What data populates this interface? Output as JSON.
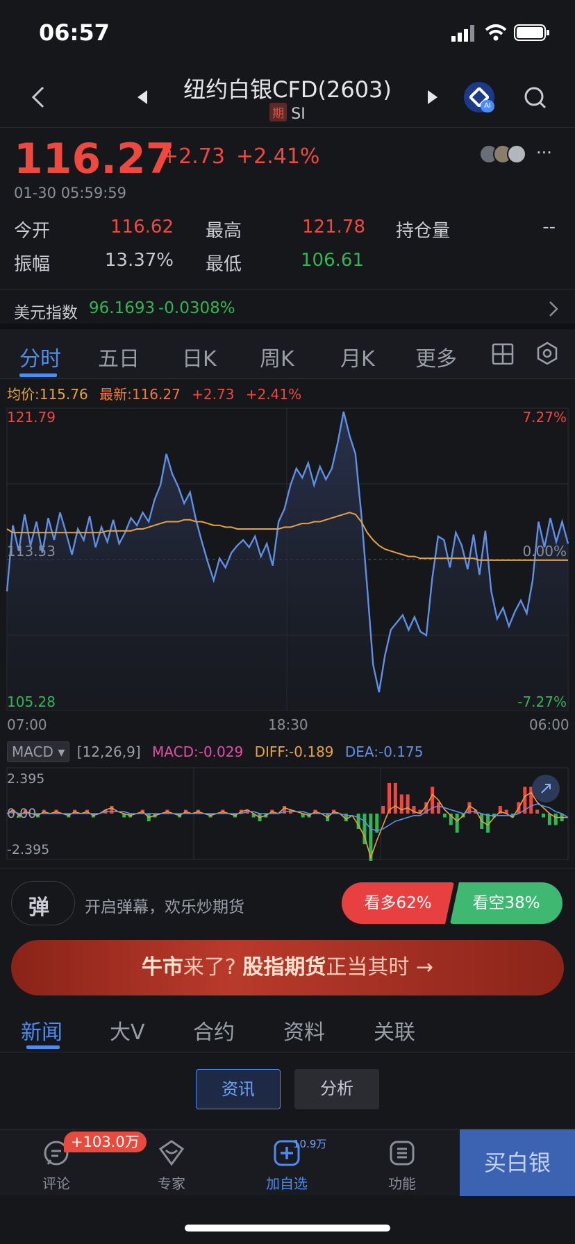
{
  "status_bar": {
    "time": "06:57"
  },
  "nav": {
    "title": "纽约白银CFD(2603)",
    "tag": "期",
    "symbol": "SI",
    "ai_badge": "AI"
  },
  "quote": {
    "price": "116.27",
    "change": "+2.73",
    "change_pct": "+2.41%",
    "timestamp": "01-30 05:59:59",
    "more": "···"
  },
  "stats": {
    "open_label": "今开",
    "open_value": "116.62",
    "high_label": "最高",
    "high_value": "121.78",
    "oi_label": "持仓量",
    "oi_value": "--",
    "amp_label": "振幅",
    "amp_value": "13.37%",
    "low_label": "最低",
    "low_value": "106.61"
  },
  "usd_index": {
    "label": "美元指数",
    "value": "96.1693",
    "change": "-0.0308%"
  },
  "chart_tabs": [
    "分时",
    "五日",
    "日K",
    "周K",
    "月K",
    "更多"
  ],
  "legend": {
    "avg": "均价:115.76",
    "latest": "最新:116.27",
    "change": "+2.73",
    "change_pct": "+2.41%"
  },
  "chart_data": [
    {
      "type": "line",
      "series": [
        {
          "name": "最新",
          "color": "#5f8fe6"
        },
        {
          "name": "均价",
          "color": "#e8a33d"
        }
      ],
      "x_ticks": [
        "07:00",
        "18:30",
        "06:00"
      ],
      "y_labels": {
        "top": "121.79",
        "mid": "113.53",
        "bottom": "105.28"
      },
      "pct_labels": {
        "top": "7.27%",
        "mid": "0.00%",
        "bottom": "-7.27%"
      },
      "ylim": [
        105.28,
        121.79
      ],
      "reference": 113.53,
      "price": [
        111.8,
        115.4,
        114.0,
        116.0,
        114.3,
        115.6,
        113.9,
        115.8,
        114.6,
        116.1,
        115.0,
        113.8,
        115.2,
        114.6,
        115.9,
        114.2,
        115.3,
        114.5,
        115.7,
        114.4,
        115.0,
        115.8,
        115.4,
        116.1,
        115.6,
        116.8,
        117.6,
        119.3,
        118.2,
        117.5,
        116.6,
        117.2,
        115.7,
        114.5,
        113.4,
        112.4,
        113.6,
        113.1,
        113.9,
        114.3,
        114.6,
        114.2,
        114.8,
        113.7,
        114.4,
        113.2,
        115.6,
        116.3,
        117.6,
        118.5,
        118.0,
        118.8,
        117.6,
        118.6,
        117.9,
        118.5,
        119.9,
        121.6,
        120.3,
        119.3,
        116.0,
        112.0,
        107.8,
        106.3,
        108.3,
        109.7,
        110.1,
        110.5,
        109.7,
        110.4,
        109.6,
        109.4,
        112.5,
        114.8,
        114.6,
        113.1,
        115.0,
        114.3,
        113.0,
        114.9,
        112.7,
        115.1,
        111.8,
        110.3,
        110.9,
        109.9,
        110.7,
        111.3,
        110.6,
        112.4,
        115.6,
        114.2,
        115.8,
        114.5,
        115.6,
        114.4
      ],
      "avg": [
        115.2,
        115.0,
        115.0,
        115.0,
        115.0,
        115.0,
        115.0,
        115.0,
        115.0,
        115.0,
        115.0,
        115.0,
        115.0,
        115.0,
        115.0,
        115.0,
        115.0,
        115.1,
        115.1,
        115.1,
        115.1,
        115.1,
        115.2,
        115.2,
        115.3,
        115.4,
        115.5,
        115.6,
        115.6,
        115.6,
        115.7,
        115.7,
        115.6,
        115.6,
        115.5,
        115.4,
        115.4,
        115.3,
        115.3,
        115.2,
        115.2,
        115.2,
        115.2,
        115.2,
        115.2,
        115.2,
        115.2,
        115.3,
        115.3,
        115.4,
        115.5,
        115.5,
        115.6,
        115.6,
        115.7,
        115.8,
        115.9,
        116.0,
        116.1,
        116.0,
        115.6,
        115.0,
        114.6,
        114.3,
        114.1,
        114.0,
        113.9,
        113.8,
        113.7,
        113.7,
        113.6,
        113.6,
        113.6,
        113.6,
        113.6,
        113.6,
        113.6,
        113.6,
        113.6,
        113.6,
        113.5,
        113.5,
        113.5,
        113.5,
        113.5,
        113.5,
        113.5,
        113.5,
        113.5,
        113.5,
        113.5,
        113.5,
        113.5,
        113.5,
        113.5,
        113.5
      ]
    },
    {
      "type": "bar",
      "indicator": "MACD",
      "params": "[12,26,9]",
      "macd": "MACD:-0.029",
      "diff": "DIFF:-0.189",
      "dea": "DEA:-0.175",
      "ylim": [
        -2.395,
        2.395
      ],
      "y_top": "2.395",
      "y_mid": "0.00",
      "y_bottom": "-2.395",
      "diff_series": [
        0.0,
        0.2,
        -0.1,
        0.1,
        0.0,
        -0.1,
        0.1,
        0.0,
        0.1,
        0.0,
        -0.1,
        0.1,
        0.0,
        0.1,
        -0.1,
        0.0,
        0.2,
        0.3,
        0.1,
        0.0,
        -0.1,
        0.0,
        0.1,
        -0.2,
        -0.1,
        0.0,
        0.1,
        0.0,
        -0.1,
        0.1,
        0.0,
        0.1,
        0.0,
        -0.1,
        0.0,
        0.1,
        0.0,
        -0.1,
        0.1,
        0.2,
        0.0,
        -0.2,
        -0.1,
        0.1,
        0.0,
        0.3,
        0.2,
        0.1,
        0.0,
        -0.1,
        0.1,
        0.0,
        -0.2,
        0.1,
        0.0,
        -0.3,
        -0.1,
        -0.6,
        -1.2,
        -2.3,
        -1.4,
        -0.6,
        0.2,
        0.4,
        0.2,
        0.3,
        0.1,
        0.0,
        0.4,
        1.0,
        0.7,
        0.2,
        -0.1,
        -0.4,
        -0.1,
        0.4,
        0.2,
        -0.4,
        -0.6,
        -0.2,
        0.1,
        0.0,
        -0.2,
        0.3,
        0.9,
        1.1,
        0.6,
        0.3,
        0.0,
        -0.2,
        -0.2,
        -0.2
      ],
      "dea_series": [
        0.0,
        0.1,
        0.0,
        0.0,
        0.0,
        0.0,
        0.0,
        0.0,
        0.0,
        0.0,
        0.0,
        0.0,
        0.0,
        0.0,
        0.0,
        0.0,
        0.1,
        0.1,
        0.1,
        0.1,
        0.0,
        0.0,
        0.0,
        0.0,
        0.0,
        0.0,
        0.0,
        0.0,
        0.0,
        0.0,
        0.0,
        0.0,
        0.0,
        0.0,
        0.0,
        0.0,
        0.0,
        0.0,
        0.0,
        0.1,
        0.1,
        0.0,
        0.0,
        0.0,
        0.0,
        0.1,
        0.1,
        0.1,
        0.1,
        0.0,
        0.0,
        0.0,
        0.0,
        0.0,
        0.0,
        -0.1,
        -0.1,
        -0.2,
        -0.4,
        -0.8,
        -0.9,
        -0.8,
        -0.6,
        -0.4,
        -0.3,
        -0.2,
        -0.1,
        -0.1,
        0.1,
        0.3,
        0.4,
        0.3,
        0.2,
        0.1,
        0.0,
        0.1,
        0.1,
        0.0,
        -0.1,
        -0.1,
        -0.1,
        -0.1,
        -0.1,
        0.0,
        0.2,
        0.4,
        0.5,
        0.4,
        0.3,
        0.1,
        0.0,
        -0.2
      ]
    }
  ],
  "danmu": {
    "icon_text": "弹",
    "text": "开启弹幕，欢乐炒期货"
  },
  "sentiment": {
    "bull": "看多62%",
    "bear": "看空38%"
  },
  "banner": {
    "part1": "牛市",
    "part2": "来了?",
    "part3": "股指期货",
    "part4": "正当其时",
    "arrow": "→"
  },
  "news_tabs": [
    "新闻",
    "大V",
    "合约",
    "资料",
    "关联"
  ],
  "chips": {
    "active": "资讯",
    "inactive": "分析"
  },
  "bottom_bar": {
    "comment": "评论",
    "comment_badge": "+103.0万",
    "expert": "专家",
    "watchlist": "加自选",
    "watch_count": "10.9万",
    "functions": "功能",
    "buy": "买白银"
  },
  "colors": {
    "up": "#f0483e",
    "down": "#32b552",
    "accent": "#4c8cf5",
    "bg": "#16171b"
  }
}
